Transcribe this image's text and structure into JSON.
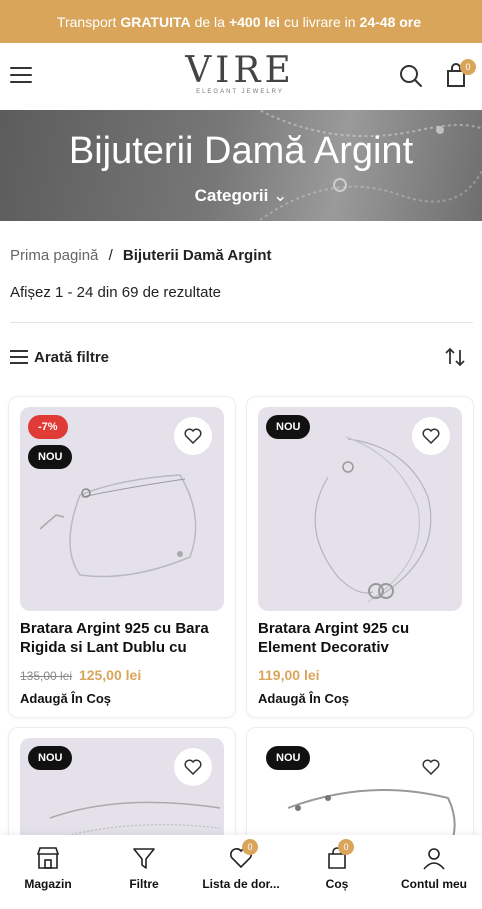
{
  "promo": {
    "pre": "Transport",
    "highlight1": "GRATUITA",
    "mid": "de la",
    "highlight2": "+400 lei",
    "mid2": "cu livrare in",
    "highlight3": "24-48 ore"
  },
  "header": {
    "logo": "VIRE",
    "logo_sub": "ELEGANT JEWELRY",
    "cart_count": "0"
  },
  "hero": {
    "title": "Bijuterii Damă Argint",
    "categories_label": "Categorii"
  },
  "breadcrumb": {
    "home": "Prima pagină",
    "separator": "/",
    "current": "Bijuterii Damă Argint"
  },
  "results": {
    "text": "Afișez 1 - 24 din 69 de rezultate"
  },
  "toolbar": {
    "filters_label": "Arată filtre"
  },
  "products": [
    {
      "sale_tag": "-7%",
      "new_tag": "NOU",
      "title": "Bratara Argint 925 cu Bara Rigida si Lant Dublu cu",
      "old_price": "135,00 lei",
      "price": "125,00 lei",
      "add_label": "Adaugă În Coș"
    },
    {
      "new_tag": "NOU",
      "title": "Bratara Argint 925 cu Element Decorativ",
      "price": "119,00 lei",
      "add_label": "Adaugă În Coș"
    },
    {
      "new_tag": "NOU"
    },
    {
      "new_tag": "NOU"
    }
  ],
  "bottom_nav": {
    "shop": "Magazin",
    "filters": "Filtre",
    "wishlist": "Lista de dor...",
    "wishlist_count": "0",
    "cart": "Coș",
    "cart_count": "0",
    "account": "Contul meu"
  },
  "colors": {
    "accent": "#d9a55b",
    "sale": "#e03b36",
    "new": "#111111"
  }
}
